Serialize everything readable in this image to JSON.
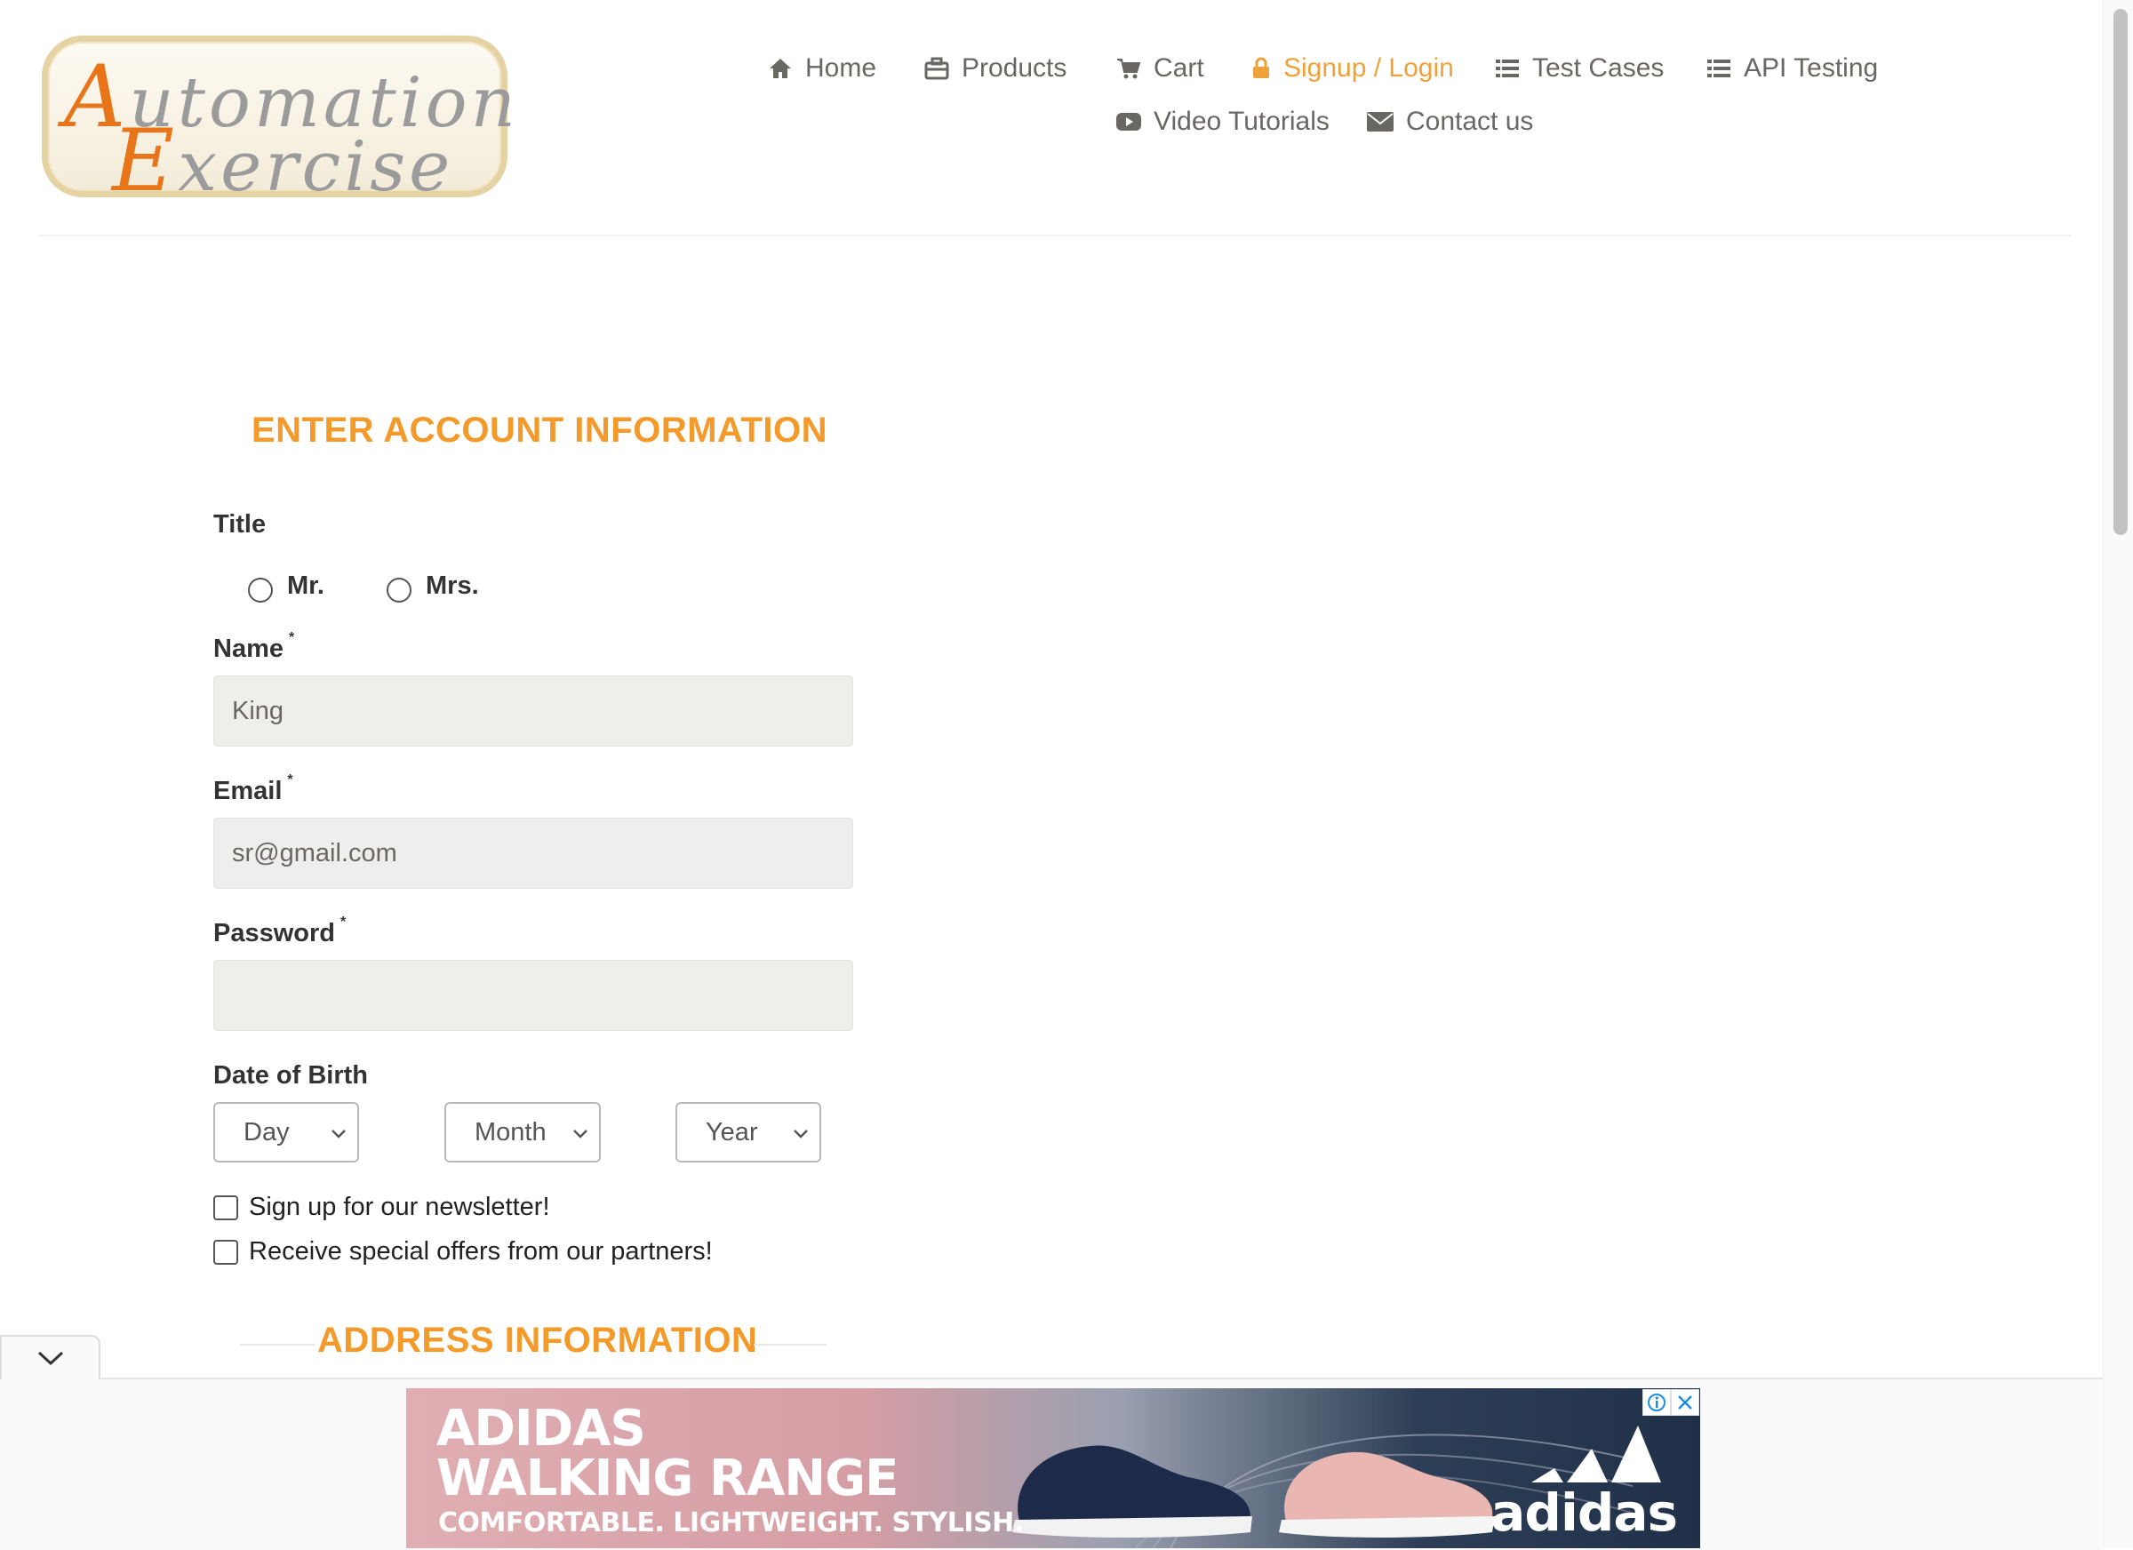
{
  "logo": {
    "line1_cap": "A",
    "line1_rest": "utomation",
    "line2_cap": "E",
    "line2_rest": "xercise"
  },
  "nav": {
    "items": [
      {
        "label": "Home",
        "icon": "home-icon"
      },
      {
        "label": "Products",
        "icon": "briefcase-icon"
      },
      {
        "label": "Cart",
        "icon": "cart-icon"
      },
      {
        "label": "Signup / Login",
        "icon": "lock-icon",
        "active": true
      },
      {
        "label": "Test Cases",
        "icon": "list-icon"
      },
      {
        "label": "API Testing",
        "icon": "list-icon"
      },
      {
        "label": "Video Tutorials",
        "icon": "youtube-play-icon"
      },
      {
        "label": "Contact us",
        "icon": "envelope-icon"
      }
    ],
    "active_color": "#f0a23a",
    "text_color": "#696763"
  },
  "form": {
    "heading": "ENTER ACCOUNT INFORMATION",
    "title_label": "Title",
    "title_options": [
      "Mr.",
      "Mrs."
    ],
    "name_label": "Name",
    "name_value": "King",
    "email_label": "Email",
    "email_value": "sr@gmail.com",
    "password_label": "Password",
    "password_value": "",
    "required_mark": "*",
    "dob_label": "Date of Birth",
    "dob_day": "Day",
    "dob_month": "Month",
    "dob_year": "Year",
    "newsletter_label": "Sign up for our newsletter!",
    "offers_label": "Receive special offers from our partners!",
    "address_heading": "ADDRESS INFORMATION",
    "accent_color": "#f39a2b"
  },
  "ad": {
    "line1": "ADIDAS",
    "line2": "WALKING RANGE",
    "line3": "COMFORTABLE. LIGHTWEIGHT. STYLISH.",
    "brand": "adidas",
    "icons": [
      "info-icon",
      "close-icon",
      "chevron-down-icon"
    ]
  }
}
